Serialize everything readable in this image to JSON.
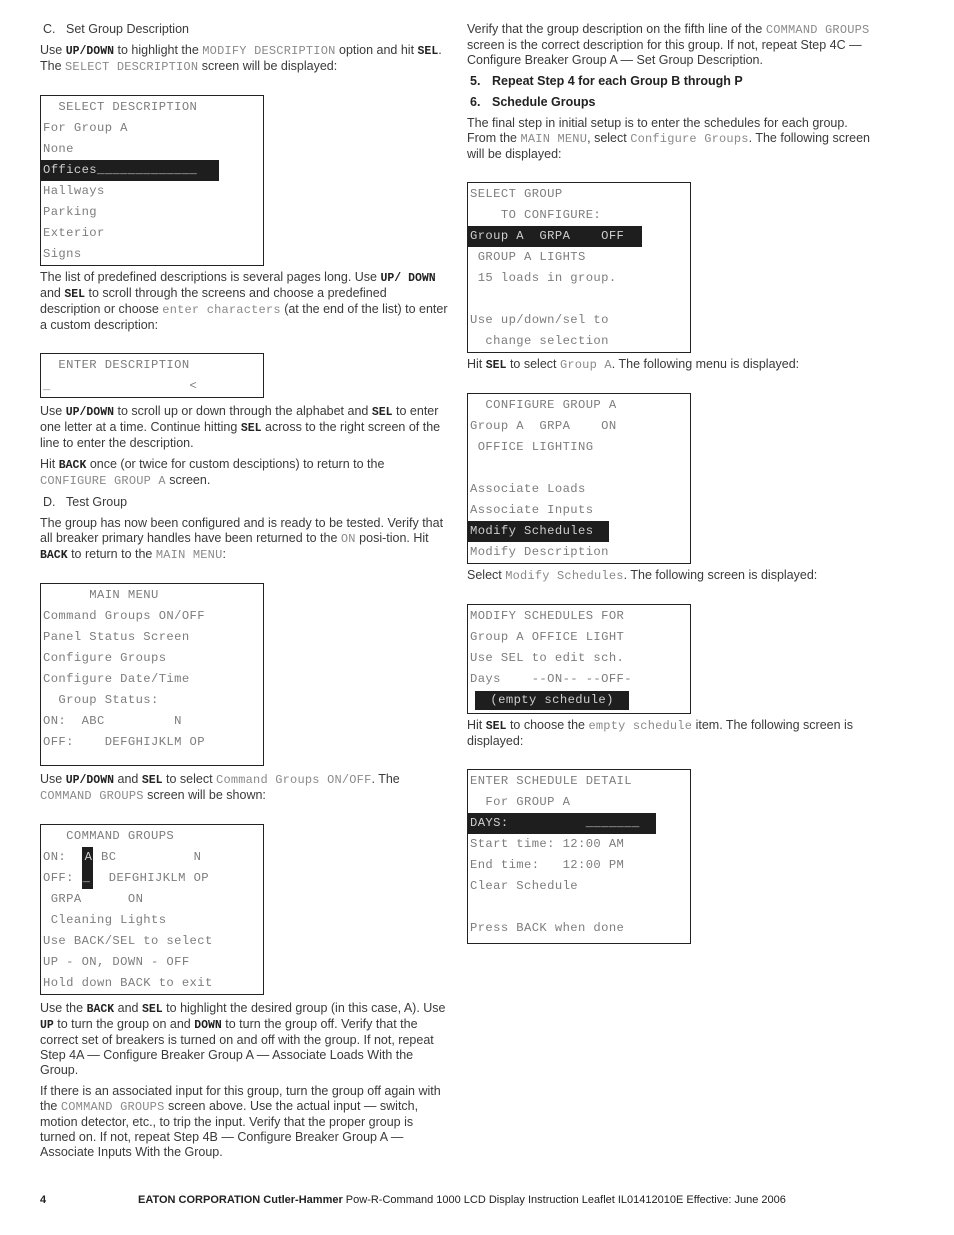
{
  "left": {
    "c_heading": {
      "letter": "C.",
      "title": "Set Group Description"
    },
    "p1": {
      "t1": "Use ",
      "k1": "UP/DOWN",
      "t2": " to highlight the ",
      "m1": "MODIFY DESCRIPTION",
      "t3": " option and hit ",
      "k2": "SEL",
      "t4": ". The ",
      "m2": "SELECT DESCRIPTION",
      "t5": " screen will be displayed:"
    },
    "screen_select_description": {
      "lines": [
        "  SELECT DESCRIPTION",
        "For Group A",
        "None",
        "Offices_____________",
        "Hallways",
        "Parking",
        "Exterior",
        "Signs"
      ],
      "highlighted_index": 3
    },
    "p2": {
      "t1": "The list of predefined descriptions is several pages long. Use ",
      "k1": "UP/ DOWN",
      "t2": " and ",
      "k2": "SEL",
      "t3": " to scroll through the screens and choose a predefined description or choose ",
      "m1": "enter characters",
      "t4": " (at the end of the list) to enter a custom description:"
    },
    "screen_enter_description": {
      "lines": [
        "  ENTER DESCRIPTION",
        "_                  <"
      ]
    },
    "p3": {
      "t1": "Use ",
      "k1": "UP/DOWN",
      "t2": " to scroll up or down through the alphabet and ",
      "k2": "SEL",
      "t3": " to enter one letter at a time. Continue hitting ",
      "k3": "SEL",
      "t4": " across to the right screen of the line to enter the description."
    },
    "p4": {
      "t1": "Hit ",
      "k1": "BACK",
      "t2": " once (or twice for custom desciptions) to return to the ",
      "m1": "CONFIGURE GROUP A",
      "t3": " screen."
    },
    "d_heading": {
      "letter": "D.",
      "title": "Test Group"
    },
    "p5": {
      "t1": "The group has now been configured and is ready to be tested. Verify that all breaker primary handles have been returned to the ",
      "m1": "ON",
      "t2": " posi-tion. Hit ",
      "k1": "BACK",
      "t3": " to return to the ",
      "m2": "MAIN MENU",
      "t4": ":"
    },
    "screen_main_menu": {
      "lines": [
        "      MAIN MENU",
        "Command Groups ON/OFF",
        "Panel Status Screen",
        "Configure Groups",
        "Configure Date/Time",
        "  Group Status:",
        "ON:  ABC         N",
        "OFF:    DEFGHIJKLM OP"
      ]
    },
    "p6": {
      "t1": "Use ",
      "k1": "UP/DOWN",
      "t2": " and ",
      "k2": "SEL",
      "t3": " to select ",
      "m1": "Command Groups ON/OFF",
      "t4": ". The ",
      "m2": "COMMAND GROUPS",
      "t5": " screen will be shown:"
    },
    "screen_command_groups": {
      "title": "   COMMAND GROUPS",
      "on_prefix": "ON:  ",
      "on_selected": "A",
      "on_rest": " BC          N",
      "off_prefix": "OFF: ",
      "off_selected": "_",
      "off_rest": "  DEFGHIJKLM OP",
      "lines": [
        " GRPA      ON",
        " Cleaning Lights",
        "Use BACK/SEL to select",
        "UP - ON, DOWN - OFF",
        "Hold down BACK to exit"
      ]
    },
    "p7": {
      "t1": "Use the ",
      "k1": "BACK",
      "t2": " and ",
      "k2": "SEL",
      "t3": " to highlight the desired group (in this case, A). Use ",
      "k3": "UP",
      "t4": " to turn the group on and ",
      "k4": "DOWN",
      "t5": " to turn the group off. Verify that the correct set of breakers is turned on and off with the group. If not, repeat Step 4A — Configure Breaker Group A — Associate Loads With the Group."
    },
    "p8": {
      "t1": "If there is an associated input for this group, turn the group off again with the ",
      "m1": "COMMAND GROUPS",
      "t2": " screen above. Use the actual input — switch, motion detector, etc., to trip the input. Verify that the proper group is turned on. If not, repeat Step 4B — Configure Breaker Group A — Associate Inputs With the Group."
    }
  },
  "right": {
    "p1": {
      "t1": "Verify that the group description on the fifth line of the ",
      "m1": "COMMAND GROUPS",
      "t2": " screen is the correct description for this group. If not, repeat Step 4C — Configure Breaker Group A — Set Group Description."
    },
    "step5": {
      "num": "5.",
      "title": "Repeat Step 4 for each Group B through P"
    },
    "step6": {
      "num": "6.",
      "title": "Schedule Groups"
    },
    "p2": {
      "t1": "The final step in initial setup is to enter the schedules for each group. From the ",
      "m1": "MAIN MENU",
      "t2": ", select ",
      "m2": "Configure Groups",
      "t3": ". The following screen will be displayed:"
    },
    "screen_select_group": {
      "lines": [
        "SELECT GROUP",
        "    TO CONFIGURE:",
        "Group A  GRPA    OFF",
        " GROUP A LIGHTS",
        " 15 loads in group.",
        "",
        "Use up/down/sel to",
        "  change selection"
      ],
      "highlighted_index": 2
    },
    "p3": {
      "t1": "Hit ",
      "k1": "SEL",
      "t2": " to select ",
      "m1": "Group A",
      "t3": ". The following menu is displayed:"
    },
    "screen_configure_group": {
      "lines": [
        "  CONFIGURE GROUP A",
        "Group A  GRPA    ON",
        " OFFICE LIGHTING",
        "",
        "Associate Loads",
        "Associate Inputs",
        "Modify Schedules ",
        "Modify Description"
      ],
      "highlighted_index": 6
    },
    "p4": {
      "t1": "Select ",
      "m1": "Modify Schedules",
      "t2": ". The following screen is displayed:"
    },
    "screen_modify_schedules": {
      "lines": [
        "MODIFY SCHEDULES FOR",
        "Group A OFFICE LIGHT",
        "Use SEL to edit sch.",
        "Days    --ON-- --OFF-"
      ],
      "selected": "  (empty schedule) "
    },
    "p5": {
      "t1": "Hit ",
      "k1": "SEL",
      "t2": " to choose the ",
      "m1": "empty schedule",
      "t3": " item. The following screen is displayed:"
    },
    "screen_schedule_detail": {
      "lines": [
        "ENTER SCHEDULE DETAIL",
        "  For GROUP A",
        "DAYS:          _______",
        "Start time: 12:00 AM",
        "End time:   12:00 PM",
        "Clear Schedule",
        "",
        "Press BACK when done"
      ],
      "highlighted_index": 2
    }
  },
  "footer": {
    "page_number": "4",
    "corporation": "EATON CORPORATION Cutler-Hammer",
    "text": " Pow-R-Command 1000 LCD Display  Instruction Leaflet IL01412010E  Effective: June 2006"
  }
}
